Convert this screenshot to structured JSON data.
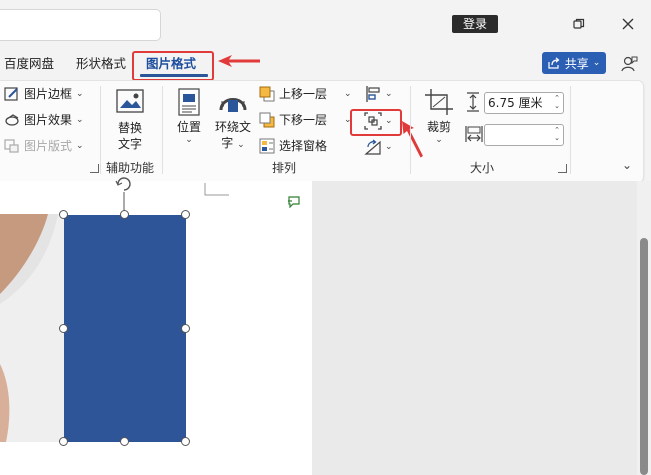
{
  "titlebar": {
    "login_label": "登录",
    "window_controls": [
      "restore-icon",
      "close-icon"
    ]
  },
  "tabs": {
    "items": [
      "百度网盘",
      "形状格式",
      "图片格式"
    ],
    "active_index": 2
  },
  "share": {
    "label": "共享"
  },
  "ribbon": {
    "adjust": {
      "picture_border": "图片边框",
      "picture_effects": "图片效果",
      "picture_layout": "图片版式"
    },
    "accessibility": {
      "alt_text_line1": "替换",
      "alt_text_line2": "文字",
      "group_label": "辅助功能"
    },
    "arrange": {
      "position": "位置",
      "wrap_text_line1": "环绕文",
      "wrap_text_line2": "字",
      "bring_forward": "上移一层",
      "send_backward": "下移一层",
      "selection_pane": "选择窗格",
      "group_label": "排列"
    },
    "size": {
      "crop": "裁剪",
      "height_value": "6.75 厘米",
      "width_value": "",
      "group_label": "大小"
    }
  },
  "colors": {
    "accent": "#2b579a",
    "shape_fill": "#2e5597",
    "highlight": "#e03a3a",
    "share_button": "#2b5fb4"
  }
}
